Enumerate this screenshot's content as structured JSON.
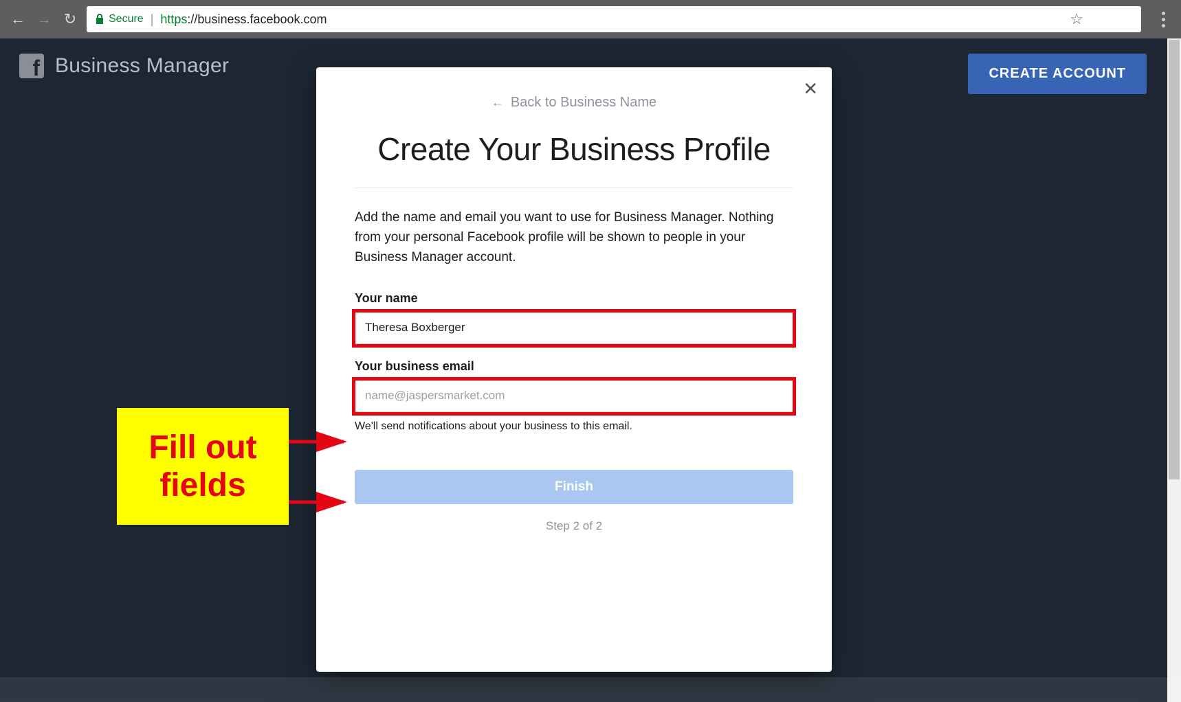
{
  "browser": {
    "secure_label": "Secure",
    "url_https": "https",
    "url_rest": "://business.facebook.com"
  },
  "header": {
    "title": "Business Manager",
    "create_account": "CREATE ACCOUNT"
  },
  "modal": {
    "back_text": "Back to Business Name",
    "title": "Create Your Business Profile",
    "description": "Add the name and email you want to use for Business Manager. Nothing from your personal Facebook profile will be shown to people in your Business Manager account.",
    "name_label": "Your name",
    "name_value": "Theresa Boxberger",
    "email_label": "Your business email",
    "email_placeholder": "name@jaspersmarket.com",
    "email_helper": "We'll send notifications about your business to this email.",
    "finish": "Finish",
    "step": "Step 2 of 2"
  },
  "annotation": {
    "text": "Fill out fields"
  }
}
